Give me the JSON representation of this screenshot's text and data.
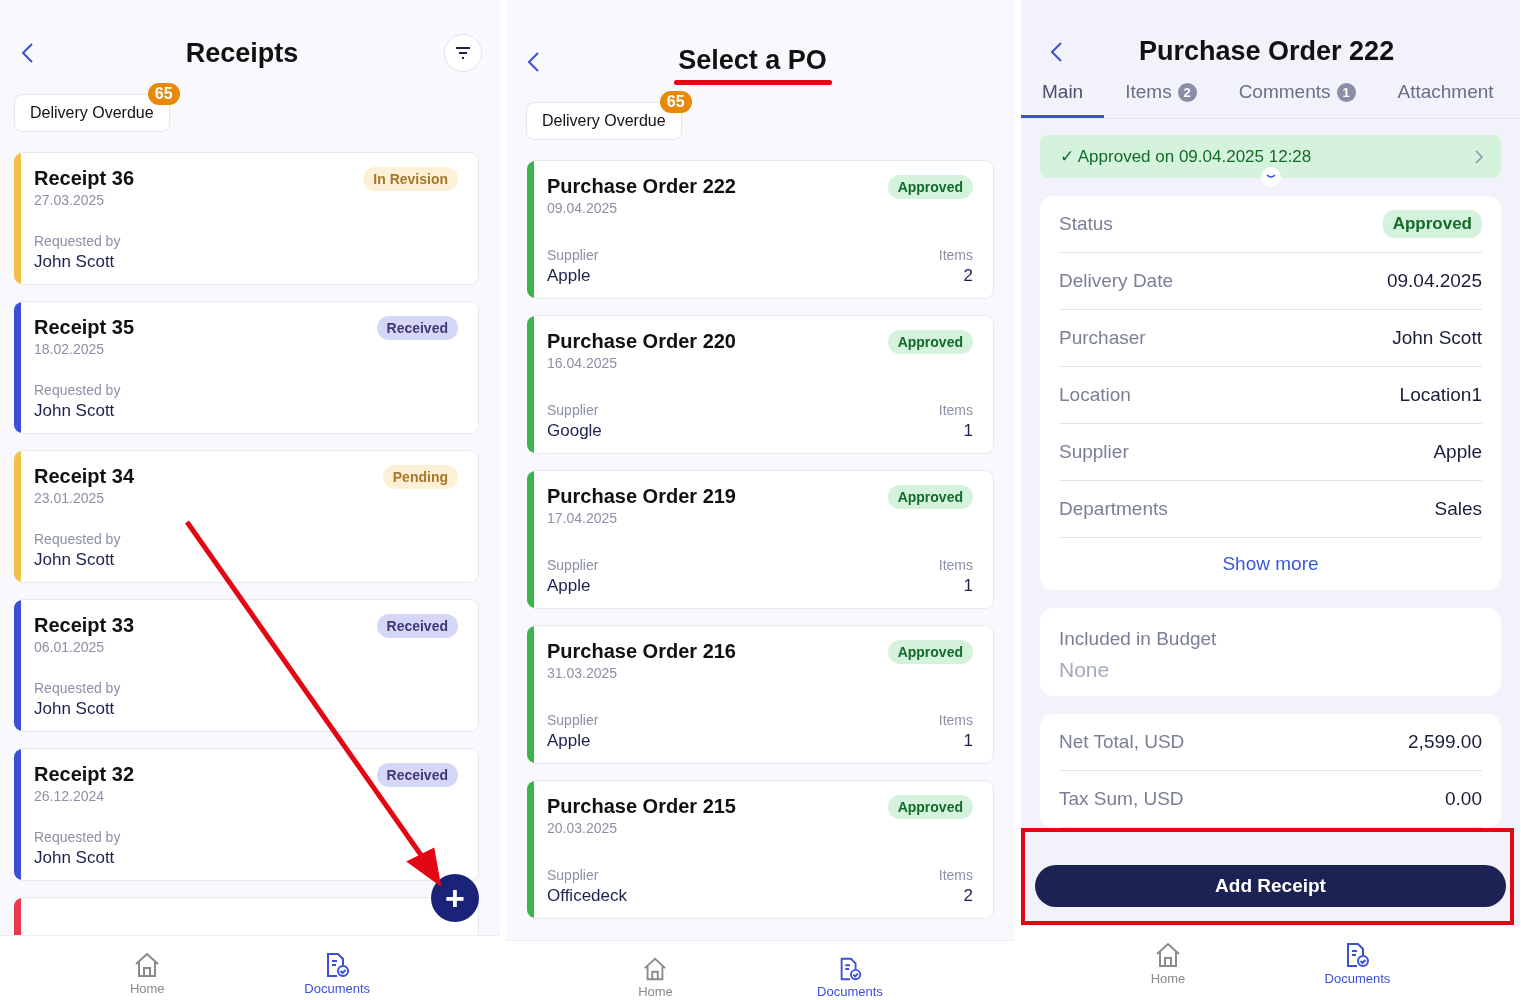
{
  "receipts_screen": {
    "title": "Receipts",
    "chip": {
      "label": "Delivery Overdue",
      "count": "65"
    },
    "cards": [
      {
        "title": "Receipt 36",
        "date": "27.03.2025",
        "label": "Requested by",
        "name": "John Scott",
        "status": "In Revision",
        "color": "#f2c14a"
      },
      {
        "title": "Receipt 35",
        "date": "18.02.2025",
        "label": "Requested by",
        "name": "John Scott",
        "status": "Received",
        "color": "#3b4fd8"
      },
      {
        "title": "Receipt 34",
        "date": "23.01.2025",
        "label": "Requested by",
        "name": "John Scott",
        "status": "Pending",
        "color": "#f2c14a"
      },
      {
        "title": "Receipt 33",
        "date": "06.01.2025",
        "label": "Requested by",
        "name": "John Scott",
        "status": "Received",
        "color": "#3b4fd8"
      },
      {
        "title": "Receipt 32",
        "date": "26.12.2024",
        "label": "Requested by",
        "name": "John Scott",
        "status": "Received",
        "color": "#3b4fd8"
      },
      {
        "color": "#e8394a"
      }
    ],
    "fab": "+",
    "nav": [
      {
        "label": "Home",
        "kind": "home",
        "selected": false
      },
      {
        "label": "Documents",
        "kind": "documents",
        "selected": true
      }
    ]
  },
  "po_screen": {
    "title": "Select a PO",
    "chip": {
      "label": "Delivery Overdue",
      "count": "65"
    },
    "cards": [
      {
        "title": "Purchase Order 222",
        "date": "09.04.2025",
        "status": "Approved",
        "supplier_label": "Supplier",
        "supplier": "Apple",
        "items_label": "Items",
        "items": "2"
      },
      {
        "title": "Purchase Order 220",
        "date": "16.04.2025",
        "status": "Approved",
        "supplier_label": "Supplier",
        "supplier": "Google",
        "items_label": "Items",
        "items": "1"
      },
      {
        "title": "Purchase Order 219",
        "date": "17.04.2025",
        "status": "Approved",
        "supplier_label": "Supplier",
        "supplier": "Apple",
        "items_label": "Items",
        "items": "1"
      },
      {
        "title": "Purchase Order 216",
        "date": "31.03.2025",
        "status": "Approved",
        "supplier_label": "Supplier",
        "supplier": "Apple",
        "items_label": "Items",
        "items": "1"
      },
      {
        "title": "Purchase Order 215",
        "date": "20.03.2025",
        "status": "Approved",
        "supplier_label": "Supplier",
        "supplier": "Officedeck",
        "items_label": "Items",
        "items": "2"
      }
    ],
    "nav": [
      {
        "label": "Home",
        "kind": "home",
        "selected": false
      },
      {
        "label": "Documents",
        "kind": "documents",
        "selected": true
      }
    ]
  },
  "detail_screen": {
    "title": "Purchase Order 222",
    "tabs": [
      {
        "label": "Main",
        "selected": true
      },
      {
        "label": "Items",
        "count": "2",
        "selected": false
      },
      {
        "label": "Comments",
        "count": "1",
        "selected": false
      },
      {
        "label": "Attachment",
        "selected": false
      }
    ],
    "approval": "✓ Approved on 09.04.2025 12:28",
    "fields": [
      {
        "label": "Status",
        "value": "Approved",
        "kind": "badge"
      },
      {
        "label": "Delivery Date",
        "value": "09.04.2025",
        "kind": "text"
      },
      {
        "label": "Purchaser",
        "value": "John Scott",
        "kind": "text"
      },
      {
        "label": "Location",
        "value": "Location1",
        "kind": "text"
      },
      {
        "label": "Supplier",
        "value": "Apple",
        "kind": "text"
      },
      {
        "label": "Departments",
        "value": "Sales",
        "kind": "text"
      }
    ],
    "show_more": "Show more",
    "budget": {
      "label": "Included in Budget",
      "value": "None"
    },
    "totals": [
      {
        "label": "Net Total, USD",
        "value": "2,599.00"
      },
      {
        "label": "Tax Sum, USD",
        "value": "0.00"
      }
    ],
    "button": "Add Receipt",
    "nav": [
      {
        "label": "Home",
        "kind": "home",
        "selected": false
      },
      {
        "label": "Documents",
        "kind": "documents",
        "selected": true
      }
    ]
  }
}
